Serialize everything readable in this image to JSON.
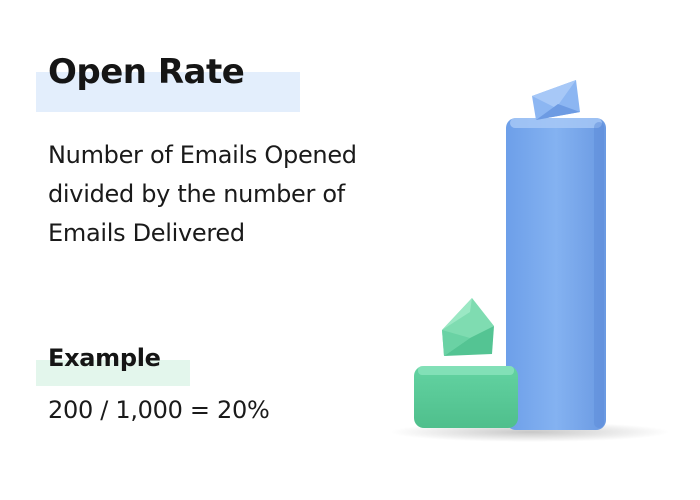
{
  "title": "Open Rate",
  "description": "Number of Emails Opened divided by the number of Emails Delivered",
  "example": {
    "heading": "Example",
    "value": "200 / 1,000 = 20%"
  },
  "colors": {
    "title_highlight": "#e3eefc",
    "example_highlight": "#e3f6ec",
    "tall_bar": "#76a6ec",
    "short_bar": "#5fcf9e"
  },
  "illustration": {
    "icons": [
      "envelope-icon",
      "envelope-icon"
    ]
  }
}
